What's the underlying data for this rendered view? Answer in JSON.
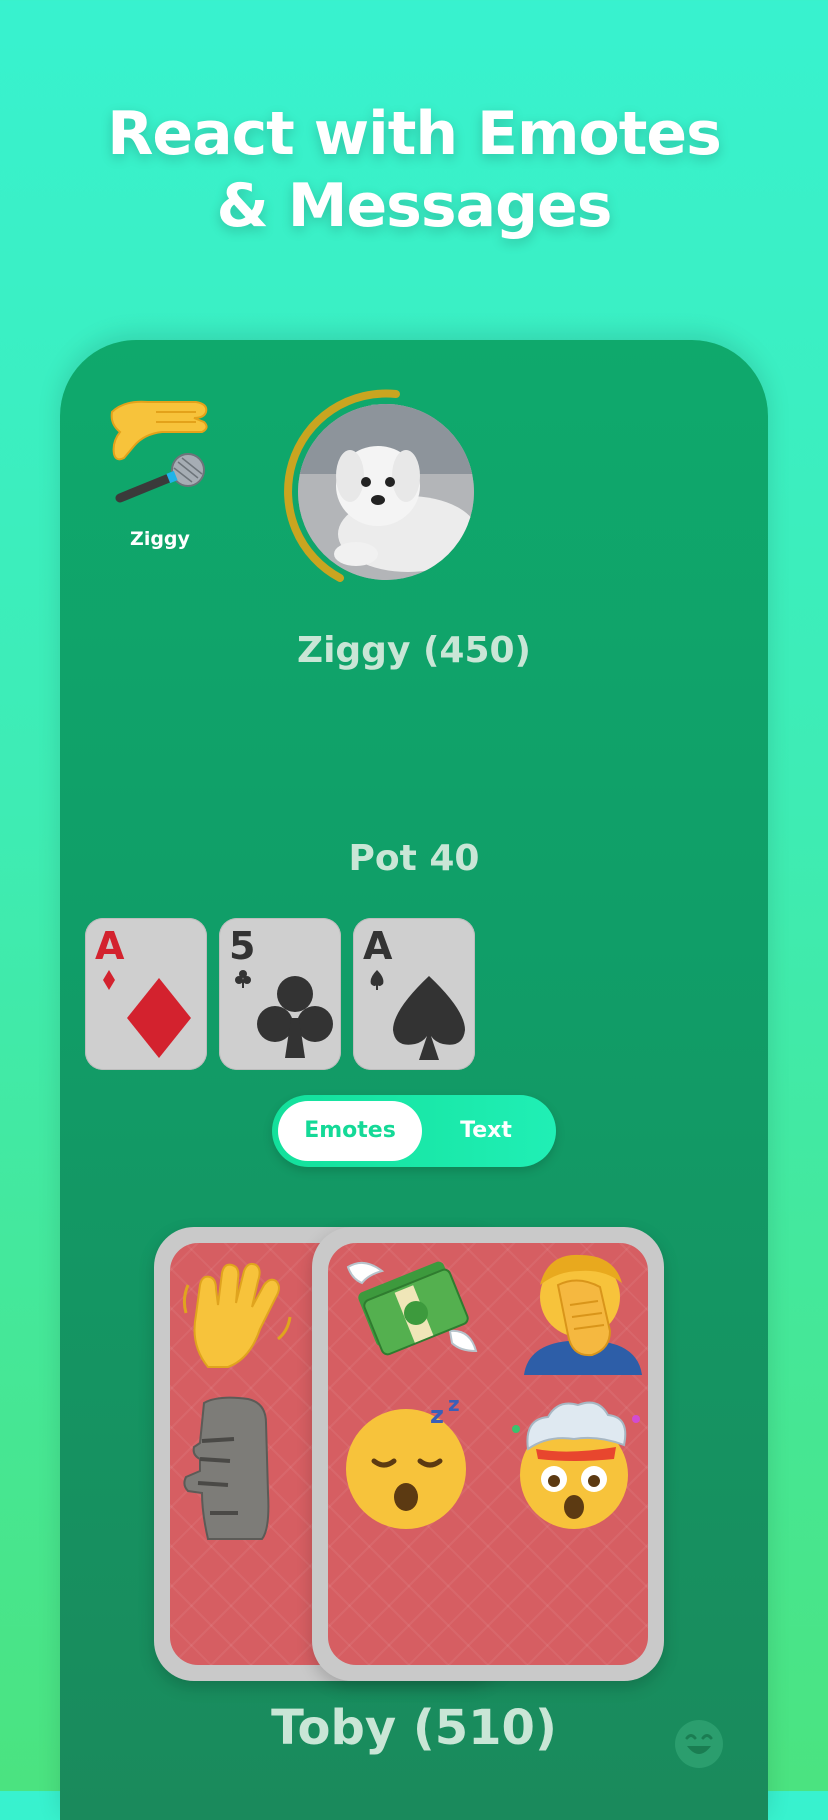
{
  "headline": {
    "line1": "React with Emotes",
    "line2": "& Messages"
  },
  "opponent": {
    "mini_name": "Ziggy",
    "display": "Ziggy (450)"
  },
  "pot": {
    "label": "Pot  40"
  },
  "board_cards": [
    {
      "rank": "A",
      "suit": "diamond",
      "color": "#d3222e"
    },
    {
      "rank": "5",
      "suit": "club",
      "color": "#333333"
    },
    {
      "rank": "A",
      "suit": "spade",
      "color": "#333333"
    }
  ],
  "toggle": {
    "active": "Emotes",
    "inactive": "Text"
  },
  "emote_icons": [
    "waving-hand",
    "moai",
    "money-with-wings",
    "face-palm",
    "sleeping-face",
    "exploding-head"
  ],
  "player": {
    "display": "Toby  (510)"
  },
  "colors": {
    "accent": "#14d997",
    "table": "#10a06a",
    "card_back": "#d65e62"
  }
}
